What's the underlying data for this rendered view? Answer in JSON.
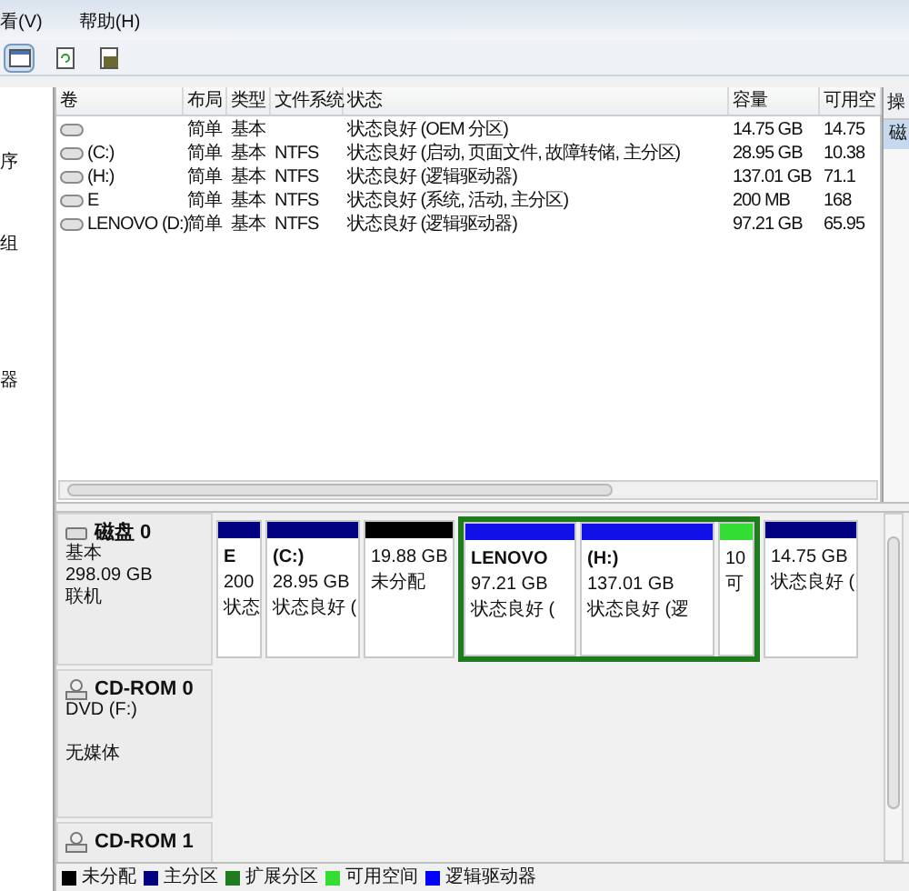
{
  "menu": [
    "看(V)",
    "帮助(H)"
  ],
  "toolbar": [
    {
      "kind": "view",
      "selected": true
    },
    {
      "kind": "refresh",
      "selected": false
    },
    {
      "kind": "properties",
      "selected": false
    }
  ],
  "sidebar": {
    "items": [
      "序",
      "组",
      "器"
    ]
  },
  "volumes": {
    "columns": [
      "卷",
      "布局",
      "类型",
      "文件系统",
      "状态",
      "容量",
      "可用空"
    ],
    "rows": [
      {
        "cells": [
          "",
          "简单",
          "基本",
          "",
          "状态良好 (OEM 分区)",
          "14.75 GB",
          "14.75"
        ]
      },
      {
        "cells": [
          "(C:)",
          "简单",
          "基本",
          "NTFS",
          "状态良好 (启动, 页面文件, 故障转储, 主分区)",
          "28.95 GB",
          "10.38"
        ]
      },
      {
        "cells": [
          "(H:)",
          "简单",
          "基本",
          "NTFS",
          "状态良好 (逻辑驱动器)",
          "137.01 GB",
          "71.1"
        ]
      },
      {
        "cells": [
          "E",
          "简单",
          "基本",
          "NTFS",
          "状态良好 (系统, 活动, 主分区)",
          "200 MB",
          "168"
        ]
      },
      {
        "cells": [
          "LENOVO (D:)",
          "简单",
          "基本",
          "NTFS",
          "状态良好 (逻辑驱动器)",
          "97.21 GB",
          "65.95"
        ]
      }
    ]
  },
  "actions": {
    "header": "操",
    "items": [
      {
        "label": "磁",
        "selected": true
      }
    ]
  },
  "disks": [
    {
      "kind": "disk",
      "name": "磁盘 0",
      "lines": [
        "基本",
        "298.09 GB",
        "联机"
      ],
      "partitions": [
        {
          "kind": "primary",
          "lines": [
            "E",
            "200",
            "状态"
          ]
        },
        {
          "kind": "primary",
          "lines": [
            "(C:)",
            "28.95 GB",
            "状态良好 ("
          ]
        },
        {
          "kind": "unallocated",
          "lines": [
            "19.88 GB",
            "未分配"
          ]
        },
        {
          "kind": "extended",
          "children": [
            {
              "kind": "logical",
              "lines": [
                "LENOVO",
                "97.21 GB",
                "状态良好 ("
              ]
            },
            {
              "kind": "logical",
              "lines": [
                "(H:)",
                "137.01 GB",
                "状态良好 (逻"
              ]
            },
            {
              "kind": "free",
              "lines": [
                "10",
                "可"
              ]
            }
          ]
        },
        {
          "kind": "primary",
          "lines": [
            "14.75 GB",
            "状态良好 ("
          ]
        }
      ]
    },
    {
      "kind": "cdrom",
      "name": "CD-ROM 0",
      "lines": [
        "DVD (F:)",
        "无媒体"
      ]
    },
    {
      "kind": "cdrom",
      "name": "CD-ROM 1"
    }
  ],
  "legend": [
    {
      "label": "未分配",
      "color": "#000000"
    },
    {
      "label": "主分区",
      "color": "#000080"
    },
    {
      "label": "扩展分区",
      "color": "#1e7b1e"
    },
    {
      "label": "可用空间",
      "color": "#33dd33"
    },
    {
      "label": "逻辑驱动器",
      "color": "#0000ff"
    }
  ]
}
